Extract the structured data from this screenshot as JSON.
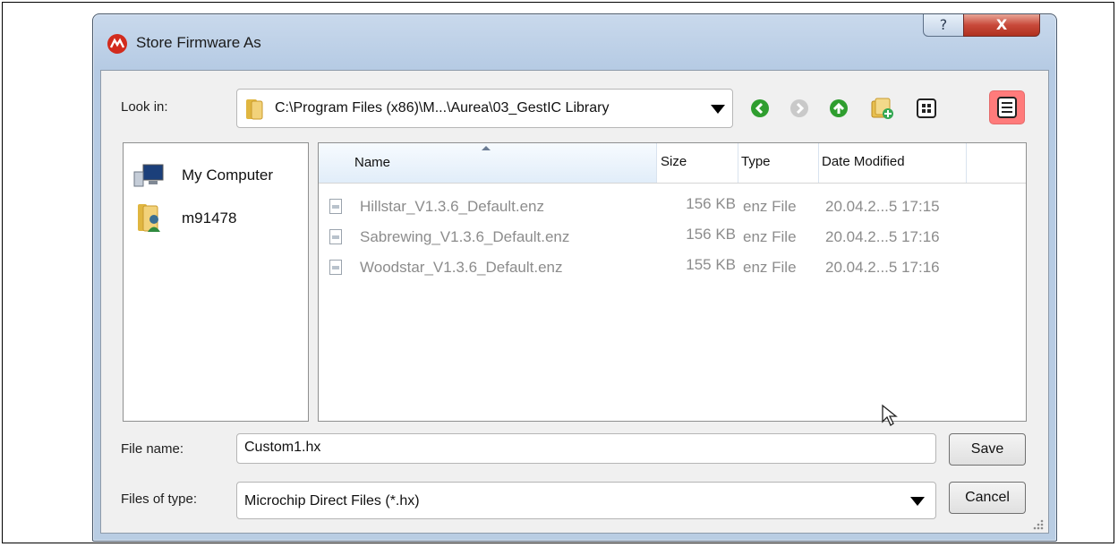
{
  "window": {
    "title": "Store Firmware As",
    "help_glyph": "?",
    "close_glyph": "X"
  },
  "look_in": {
    "label": "Look in:",
    "path": "C:\\Program Files (x86)\\M...\\Aurea\\03_GestIC Library"
  },
  "toolbar": {
    "icons": [
      "back-icon",
      "forward-icon",
      "up-folder-icon",
      "new-folder-icon",
      "list-view-icon",
      "detail-view-icon"
    ]
  },
  "sidebar": {
    "items": [
      {
        "label": "My Computer",
        "icon": "computer-icon"
      },
      {
        "label": "m91478",
        "icon": "user-folder-icon"
      }
    ]
  },
  "file_list": {
    "columns": [
      "Name",
      "Size",
      "Type",
      "Date Modified"
    ],
    "rows": [
      {
        "name": "Hillstar_V1.3.6_Default.enz",
        "size": "156 KB",
        "type": "enz File",
        "date": "20.04.2...5 17:15"
      },
      {
        "name": "Sabrewing_V1.3.6_Default.enz",
        "size": "156 KB",
        "type": "enz File",
        "date": "20.04.2...5 17:16"
      },
      {
        "name": "Woodstar_V1.3.6_Default.enz",
        "size": "155 KB",
        "type": "enz File",
        "date": "20.04.2...5 17:16"
      }
    ]
  },
  "file_name": {
    "label": "File name:",
    "value": "Custom1.hx"
  },
  "file_type": {
    "label": "Files of type:",
    "value": "Microchip Direct Files (*.hx)"
  },
  "buttons": {
    "save": "Save",
    "cancel": "Cancel"
  },
  "colors": {
    "accent_detail_view": "#ff7b7b",
    "nav_green": "#2f9e2f",
    "title_bar": "#b6cbe4"
  }
}
